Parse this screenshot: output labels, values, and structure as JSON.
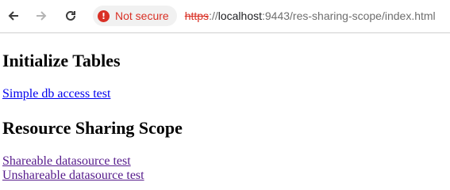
{
  "browser": {
    "security_chip": "Not secure",
    "url": {
      "scheme": "https",
      "separator": "://",
      "host": "localhost",
      "rest": ":9443/res-sharing-scope/index.html"
    }
  },
  "page": {
    "heading_initialize": "Initialize Tables",
    "link_simple_db": "Simple db access test",
    "heading_scope": "Resource Sharing Scope",
    "link_shareable": "Shareable datasource test",
    "link_unshareable": "Unshareable datasource test"
  },
  "colors": {
    "link_unvisited": "#0000ee",
    "link_visited": "#551a8b",
    "warning": "#d93025"
  },
  "icons": {
    "back": "arrow-left-icon",
    "forward": "arrow-right-icon",
    "reload": "reload-icon",
    "security": "warning-icon"
  }
}
